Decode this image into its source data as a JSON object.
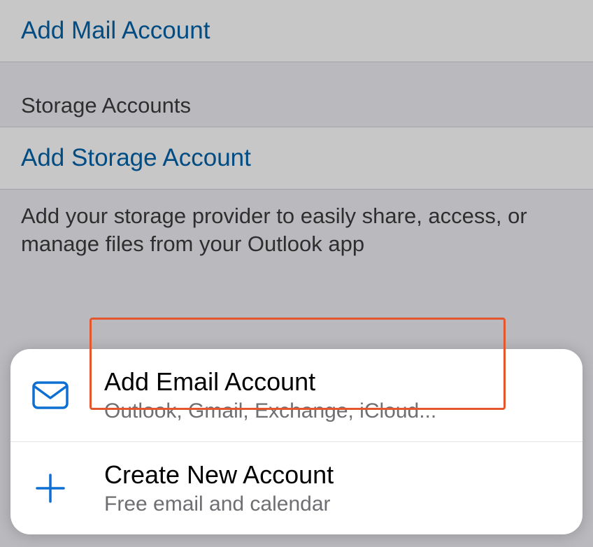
{
  "mailSection": {
    "addMailLabel": "Add Mail Account"
  },
  "storageSection": {
    "header": "Storage Accounts",
    "addStorageLabel": "Add Storage Account",
    "footer": "Add your storage provider to easily share, access, or manage files from your Outlook app"
  },
  "actionSheet": {
    "addEmail": {
      "title": "Add Email Account",
      "subtitle": "Outlook, Gmail, Exchange, iCloud..."
    },
    "createAccount": {
      "title": "Create New Account",
      "subtitle": "Free email and calendar"
    }
  },
  "colors": {
    "accent": "#0d6fd1",
    "highlight": "#e4572e"
  }
}
